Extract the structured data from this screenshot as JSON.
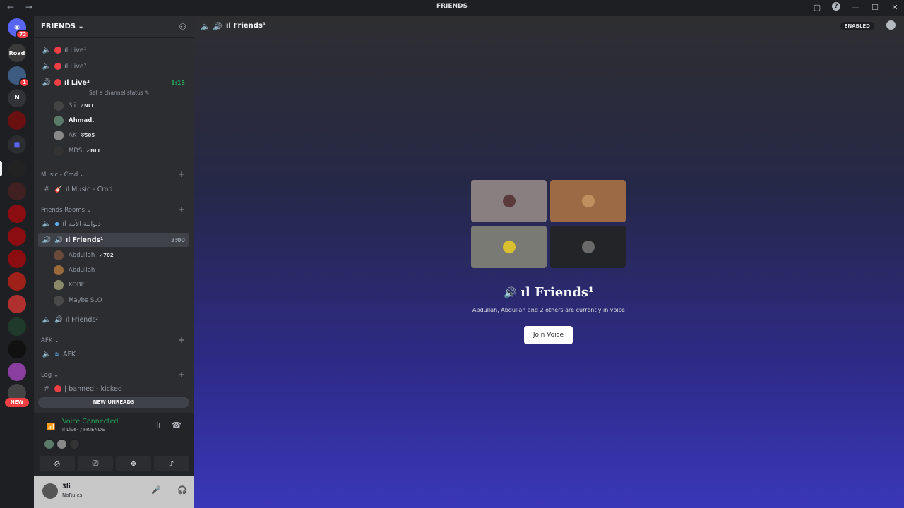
{
  "titlebar": {
    "title": "FRIENDS",
    "nav": "← →"
  },
  "server_list": {
    "home_badge": "72",
    "road_label": "Road",
    "n_label": "N",
    "new_pill": "NEW"
  },
  "guild": {
    "name": "FRIENDS ⌄"
  },
  "channels": {
    "live1": "ıl Live¹",
    "live2": "ıl Live²",
    "live3": "ıl Live³",
    "live3_timer": "1:15",
    "live3_status": "Set a channel status ✎",
    "live3_users": [
      {
        "name": "3li",
        "tag": "✓NLL"
      },
      {
        "name": "Ahmad.",
        "tag": ""
      },
      {
        "name": "AK",
        "tag": "⛨505"
      },
      {
        "name": "MDS",
        "tag": "✓NLL"
      }
    ],
    "cat_music": "Music - Cmd ⌄",
    "music_cmd": "ıl Music - Cmd",
    "cat_friends": "Friends Rooms ⌄",
    "diwaniya": "ıl ديوانية الأمه",
    "friends1": "ıl Friends¹",
    "friends1_timer": "3:00",
    "friends1_users": [
      {
        "name": "Abdullah",
        "tag": "✓702"
      },
      {
        "name": "Abdullah",
        "tag": ""
      },
      {
        "name": "KOBE",
        "tag": ""
      },
      {
        "name": "Maybe SLO",
        "tag": ""
      }
    ],
    "friends2": "ıl Friends²",
    "cat_afk": "AFK ⌄",
    "afk": "AFK",
    "cat_log": "Log ⌄",
    "banned": "| banned - kicked",
    "new_unreads": "NEW UNREADS"
  },
  "voice_panel": {
    "title": "Voice Connected",
    "subtitle": "ıl Live³ / FRIENDS"
  },
  "user_panel": {
    "name": "3li",
    "status": "NoRules"
  },
  "main": {
    "header_title": "ıl Friends¹",
    "enabled_badge": "ENABLED",
    "channel_title": "ıl Friends¹",
    "description": "Abdullah, Abdullah and 2 others are currently in voice",
    "join_button": "Join Voice"
  },
  "colors": {
    "accent_green": "#23a559",
    "red": "#f23f43",
    "blurple": "#5865f2"
  }
}
